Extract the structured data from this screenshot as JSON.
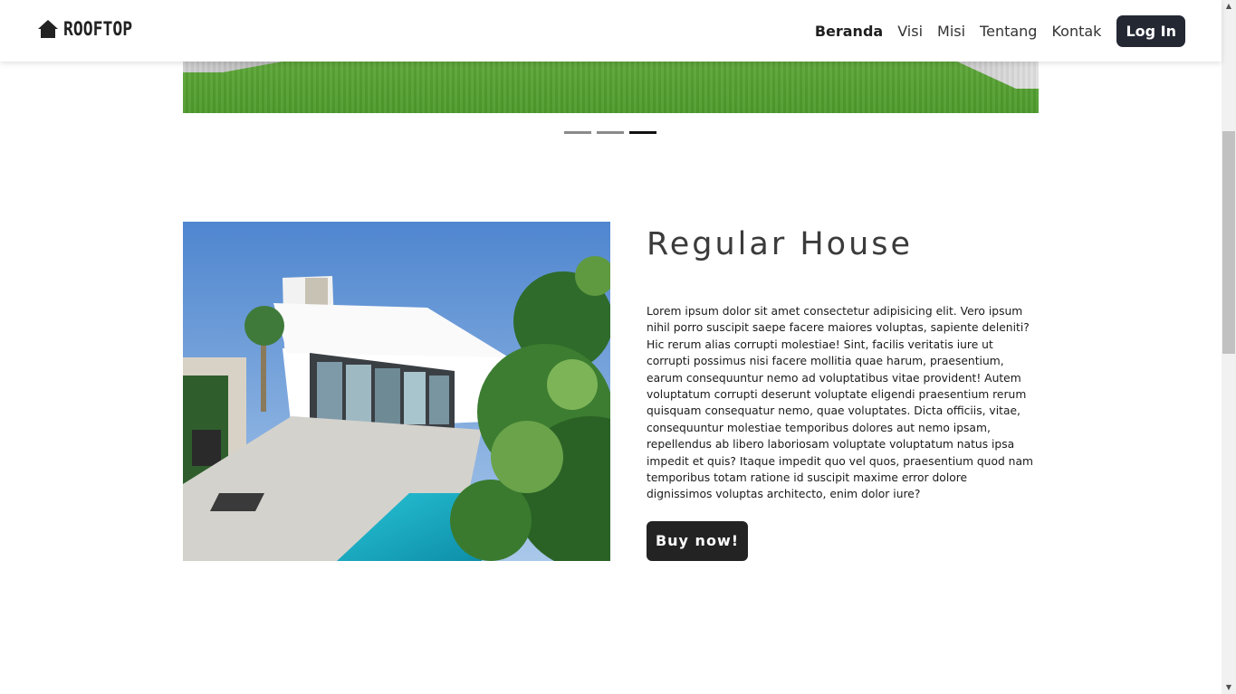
{
  "brand": {
    "name": "ROOFTOP",
    "icon": "house-icon"
  },
  "nav": {
    "items": [
      {
        "label": "Beranda",
        "active": true
      },
      {
        "label": "Visi",
        "active": false
      },
      {
        "label": "Misi",
        "active": false
      },
      {
        "label": "Tentang",
        "active": false
      },
      {
        "label": "Kontak",
        "active": false
      }
    ],
    "login_label": "Log In"
  },
  "carousel": {
    "slide_count": 3,
    "active_index": 2
  },
  "product": {
    "title": "Regular House",
    "description": "Lorem ipsum dolor sit amet consectetur adipisicing elit. Vero ipsum nihil porro suscipit saepe facere maiores voluptas, sapiente deleniti? Hic rerum alias corrupti molestiae! Sint, facilis veritatis iure ut corrupti possimus nisi facere mollitia quae harum, praesentium, earum consequuntur nemo ad voluptatibus vitae provident! Autem voluptatum corrupti deserunt voluptate eligendi praesentium rerum quisquam consequatur nemo, quae voluptates. Dicta officiis, vitae, consequuntur molestiae temporibus dolores aut nemo ipsam, repellendus ab libero laboriosam voluptate voluptatum natus ipsa impedit et quis? Itaque impedit quo vel quos, praesentium quod nam temporibus totam ratione id suscipit maxime error dolore dignissimos voluptas architecto, enim dolor iure?",
    "buy_label": "Buy now!"
  },
  "colors": {
    "navbar_button": "#232833",
    "buy_button": "#232323",
    "indicator_active": "#111111",
    "indicator_inactive": "#8a8a8a"
  }
}
